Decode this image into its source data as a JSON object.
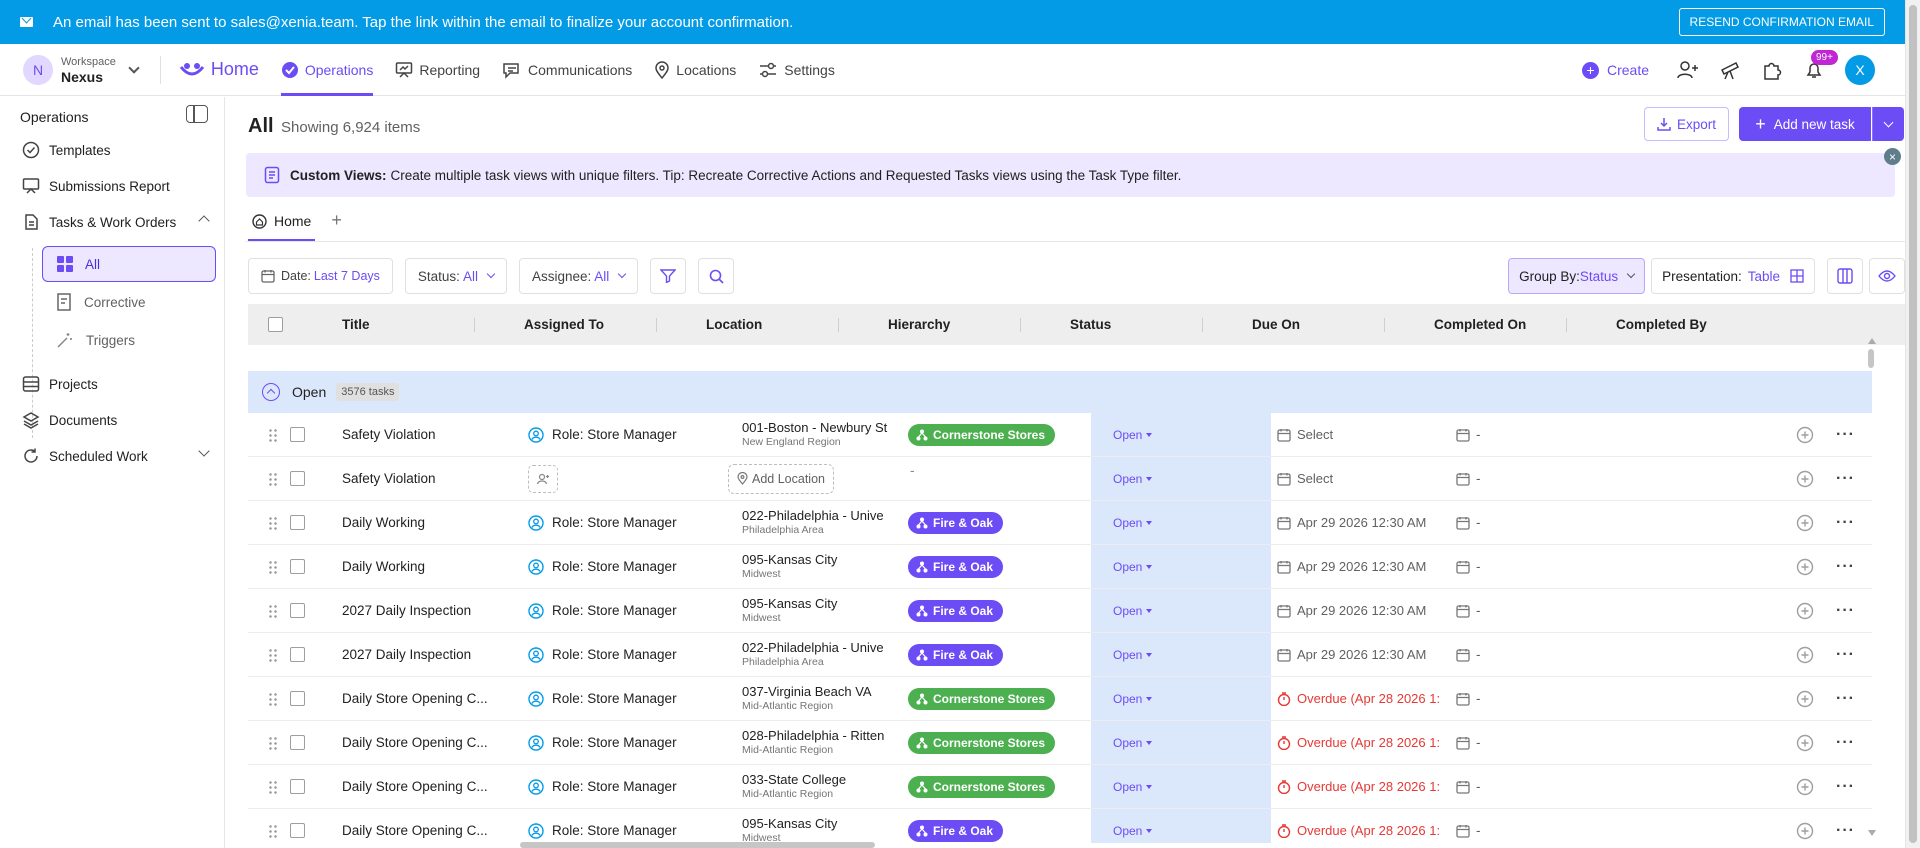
{
  "banner": {
    "message": "An email has been sent to sales@xenia.team. Tap the link within the email to finalize your account confirmation.",
    "resend_label": "RESEND CONFIRMATION EMAIL"
  },
  "workspace": {
    "label": "Workspace",
    "name": "Nexus",
    "initial": "N"
  },
  "nav": {
    "home": "Home",
    "items": [
      "Operations",
      "Reporting",
      "Communications",
      "Locations",
      "Settings"
    ],
    "create": "Create",
    "notifications_badge": "99+",
    "user_initial": "X"
  },
  "sidebar": {
    "title": "Operations",
    "items": [
      "Templates",
      "Submissions Report",
      "Tasks & Work Orders",
      "Projects",
      "Documents",
      "Scheduled Work"
    ],
    "sub_items": [
      "All",
      "Corrective",
      "Triggers"
    ]
  },
  "main": {
    "title": "All",
    "count": "Showing 6,924 items",
    "export_label": "Export",
    "add_label": "Add new task",
    "tip_bold": "Custom Views:",
    "tip_text": "Create multiple task views with unique filters. Tip: Recreate Corrective Actions and Requested Tasks views using the Task Type filter.",
    "tab_home": "Home",
    "tab_add": "+",
    "filters": {
      "date_label": "Date:",
      "date_value": "Last 7 Days",
      "status_label": "Status:",
      "status_value": "All",
      "assignee_label": "Assignee:",
      "assignee_value": "All",
      "group_label": "Group By:",
      "group_value": "Status",
      "presentation_label": "Presentation:",
      "presentation_value": "Table"
    },
    "columns": [
      "Title",
      "Assigned To",
      "Location",
      "Hierarchy",
      "Status",
      "Due On",
      "Completed On",
      "Completed By"
    ],
    "group": {
      "label": "Open",
      "count": "3576 tasks"
    }
  },
  "colors": {
    "accent": "#6c4cf5",
    "banner": "#039be5",
    "green_pill": "#4caf50",
    "purple_pill": "#6c4cf5",
    "overdue": "#e53935"
  },
  "rows": [
    {
      "title": "Safety Violation",
      "assignee": "Role: Store Manager",
      "loc1": "001-Boston - Newbury St",
      "loc2": "New England Region",
      "hier": "Cornerstone Stores",
      "hier_color": "green",
      "status": "Open",
      "due": "Select",
      "due_type": "select",
      "completed": "-"
    },
    {
      "title": "Safety Violation",
      "assignee": "",
      "loc1": "",
      "loc2": "",
      "add_location": "Add Location",
      "hier": "-",
      "hier_color": "none",
      "status": "Open",
      "due": "Select",
      "due_type": "select",
      "completed": "-"
    },
    {
      "title": "Daily Working",
      "assignee": "Role: Store Manager",
      "loc1": "022-Philadelphia - Unive",
      "loc2": "Philadelphia Area",
      "hier": "Fire & Oak",
      "hier_color": "purple",
      "status": "Open",
      "due": "Apr 29 2026 12:30 AM",
      "due_type": "date",
      "completed": "-"
    },
    {
      "title": "Daily Working",
      "assignee": "Role: Store Manager",
      "loc1": "095-Kansas City",
      "loc2": "Midwest",
      "hier": "Fire & Oak",
      "hier_color": "purple",
      "status": "Open",
      "due": "Apr 29 2026 12:30 AM",
      "due_type": "date",
      "completed": "-"
    },
    {
      "title": "2027 Daily Inspection",
      "assignee": "Role: Store Manager",
      "loc1": "095-Kansas City",
      "loc2": "Midwest",
      "hier": "Fire & Oak",
      "hier_color": "purple",
      "status": "Open",
      "due": "Apr 29 2026 12:30 AM",
      "due_type": "date",
      "completed": "-"
    },
    {
      "title": "2027 Daily Inspection",
      "assignee": "Role: Store Manager",
      "loc1": "022-Philadelphia - Unive",
      "loc2": "Philadelphia Area",
      "hier": "Fire & Oak",
      "hier_color": "purple",
      "status": "Open",
      "due": "Apr 29 2026 12:30 AM",
      "due_type": "date",
      "completed": "-"
    },
    {
      "title": "Daily Store Opening C...",
      "assignee": "Role: Store Manager",
      "loc1": "037-Virginia Beach VA",
      "loc2": "Mid-Atlantic Region",
      "hier": "Cornerstone Stores",
      "hier_color": "green",
      "status": "Open",
      "due": "Overdue (Apr 28 2026 1:",
      "due_type": "overdue",
      "completed": "-"
    },
    {
      "title": "Daily Store Opening C...",
      "assignee": "Role: Store Manager",
      "loc1": "028-Philadelphia - Ritten",
      "loc2": "Mid-Atlantic Region",
      "hier": "Cornerstone Stores",
      "hier_color": "green",
      "status": "Open",
      "due": "Overdue (Apr 28 2026 1:",
      "due_type": "overdue",
      "completed": "-"
    },
    {
      "title": "Daily Store Opening C...",
      "assignee": "Role: Store Manager",
      "loc1": "033-State College",
      "loc2": "Mid-Atlantic Region",
      "hier": "Cornerstone Stores",
      "hier_color": "green",
      "status": "Open",
      "due": "Overdue (Apr 28 2026 1:",
      "due_type": "overdue",
      "completed": "-"
    },
    {
      "title": "Daily Store Opening C...",
      "assignee": "Role: Store Manager",
      "loc1": "095-Kansas City",
      "loc2": "Midwest",
      "hier": "Fire & Oak",
      "hier_color": "purple",
      "status": "Open",
      "due": "Overdue (Apr 28 2026 1:",
      "due_type": "overdue",
      "completed": "-"
    }
  ]
}
